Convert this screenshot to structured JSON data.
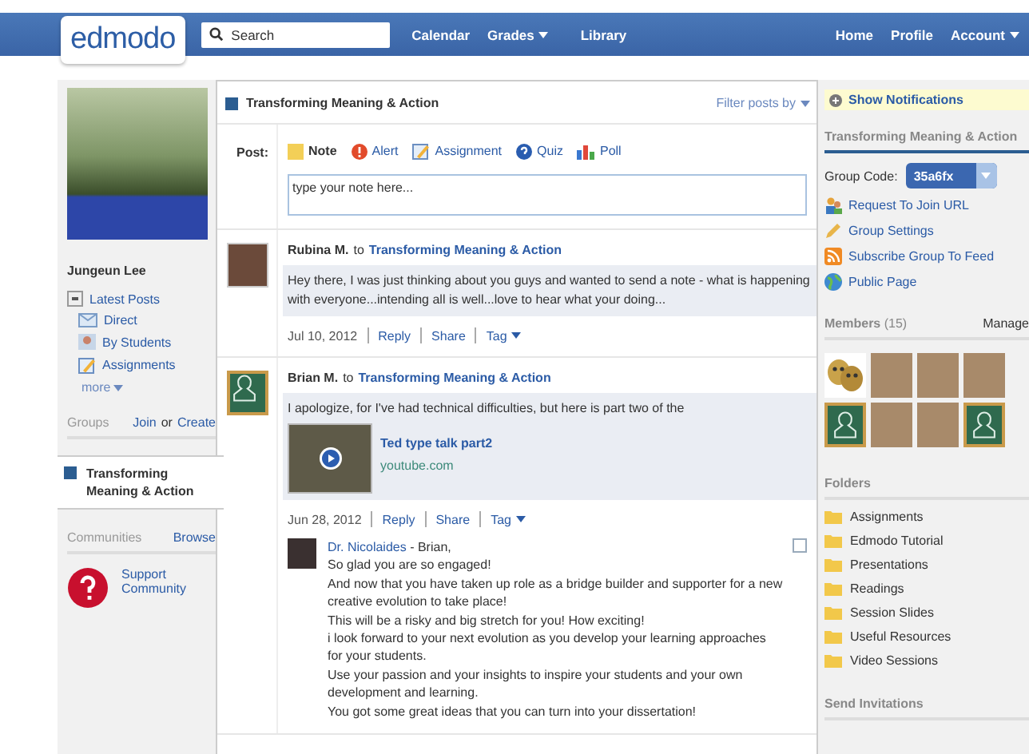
{
  "topbar": {
    "logo": "edmodo",
    "search": {
      "placeholder": "Search"
    },
    "nav_left": [
      {
        "label": "Calendar",
        "dropdown": false
      },
      {
        "label": "Grades",
        "dropdown": true
      },
      {
        "label": "Library",
        "dropdown": false
      }
    ],
    "nav_right": [
      {
        "label": "Home",
        "dropdown": false
      },
      {
        "label": "Profile",
        "dropdown": false
      },
      {
        "label": "Account",
        "dropdown": true
      }
    ]
  },
  "sidebar": {
    "user_name": "Jungeun Lee",
    "feeds": [
      {
        "label": "Latest Posts",
        "kind": "latest"
      },
      {
        "label": "Direct",
        "kind": "direct"
      },
      {
        "label": "By Students",
        "kind": "students"
      },
      {
        "label": "Assignments",
        "kind": "assignments"
      }
    ],
    "more": "more",
    "groups_title": "Groups",
    "join": "Join",
    "or": "or",
    "create": "Create",
    "groups": [
      {
        "label": "Transforming Meaning & Action",
        "selected": true
      }
    ],
    "communities_title": "Communities",
    "browse": "Browse",
    "communities": [
      {
        "label": "Support Community"
      }
    ]
  },
  "stream": {
    "title": "Transforming Meaning & Action",
    "filter": "Filter posts by",
    "composer": {
      "label": "Post:",
      "types": [
        {
          "label": "Note",
          "kind": "note",
          "selected": true
        },
        {
          "label": "Alert",
          "kind": "alert",
          "selected": false
        },
        {
          "label": "Assignment",
          "kind": "assignment",
          "selected": false
        },
        {
          "label": "Quiz",
          "kind": "quiz",
          "selected": false
        },
        {
          "label": "Poll",
          "kind": "poll",
          "selected": false
        }
      ],
      "value": "type your note here..."
    },
    "posts": [
      {
        "author": "Rubina M.",
        "to": "to",
        "group": "Transforming Meaning & Action",
        "kind": "photo",
        "text": "Hey there, I was just thinking about you guys and wanted to send a note - what is happening with everyone...intending all is well...love to hear what your doing...",
        "date": "Jul 10, 2012",
        "actions": [
          "Reply",
          "Share",
          "Tag"
        ]
      },
      {
        "author": "Brian M.",
        "to": "to",
        "group": "Transforming Meaning & Action",
        "kind": "default",
        "text": "I apologize, for I've had technical difficulties, but here is part two of the",
        "link": {
          "title": "Ted type talk part2",
          "source": "youtube.com"
        },
        "date": "Jun 28, 2012",
        "actions": [
          "Reply",
          "Share",
          "Tag"
        ],
        "replies": [
          {
            "author": "Dr. Nicolaides",
            "lines": [
              " - Brian,",
              "So glad you are so engaged!",
              "And now that you have taken up role as a bridge builder and supporter for a new creative evolution to take place!",
              "This will be a risky and big stretch for you! How exciting!",
              "i look forward to your next evolution as you develop your learning approaches for your students.",
              "Use your passion and your insights to inspire your students and your own development and learning.",
              "You got some great ideas that you can turn into your dissertation!"
            ]
          }
        ]
      }
    ]
  },
  "rightbar": {
    "notifications": "Show Notifications",
    "group_title": "Transforming Meaning & Action",
    "code_label": "Group Code:",
    "code": "35a6fx",
    "links": [
      {
        "label": "Request To Join URL",
        "kind": "request"
      },
      {
        "label": "Group Settings",
        "kind": "settings"
      },
      {
        "label": "Subscribe Group To Feed",
        "kind": "feed"
      },
      {
        "label": "Public Page",
        "kind": "public"
      }
    ],
    "members_title": "Members",
    "members_count": "(15)",
    "manage": "Manage",
    "members": [
      {
        "kind": "masks"
      },
      {
        "kind": "photo"
      },
      {
        "kind": "photo"
      },
      {
        "kind": "photo"
      },
      {
        "kind": "default"
      },
      {
        "kind": "photo"
      },
      {
        "kind": "photo"
      },
      {
        "kind": "default"
      }
    ],
    "folders_title": "Folders",
    "folders": [
      "Assignments",
      "Edmodo Tutorial",
      "Presentations",
      "Readings",
      "Session Slides",
      "Useful Resources",
      "Video Sessions"
    ],
    "invitations_title": "Send Invitations"
  }
}
